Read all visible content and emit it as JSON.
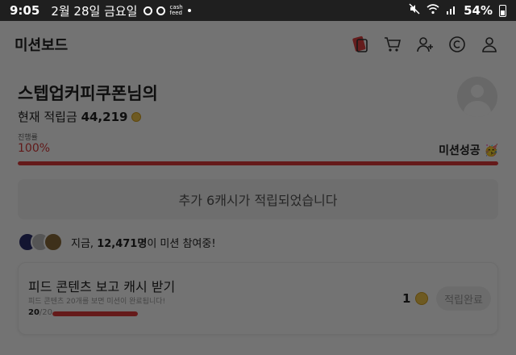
{
  "statusbar": {
    "time": "9:05",
    "date": "2월 28일 금요일",
    "app_text": "cash\nfeed",
    "battery": "54%"
  },
  "header": {
    "title": "미션보드",
    "icons": [
      "mission-card-icon",
      "cart-icon",
      "add-user-icon",
      "coin-c-icon",
      "user-icon"
    ]
  },
  "profile": {
    "nickname": "스텝업커피쿠폰님의",
    "points_label": "현재 적립금",
    "points_value": "44,219"
  },
  "progress": {
    "label": "진행률",
    "value": "100%",
    "percent": 100,
    "success_text": "미션성공 🥳"
  },
  "banner": {
    "text": "추가 6캐시가 적립되었습니다"
  },
  "participants": {
    "prefix": "지금, ",
    "count": "12,471명",
    "suffix": "이 미션 참여중!"
  },
  "mission": {
    "title": "피드 콘텐츠 보고 캐시 받기",
    "desc": "피드 콘텐츠 20개를 보면 미션이 완료됩니다!",
    "current": "20",
    "total": "/20",
    "fraction": 1.0,
    "reward": "1",
    "button_label": "적립완료"
  },
  "colors": {
    "accent": "#e03a3a",
    "coin": "#f3c74c"
  }
}
